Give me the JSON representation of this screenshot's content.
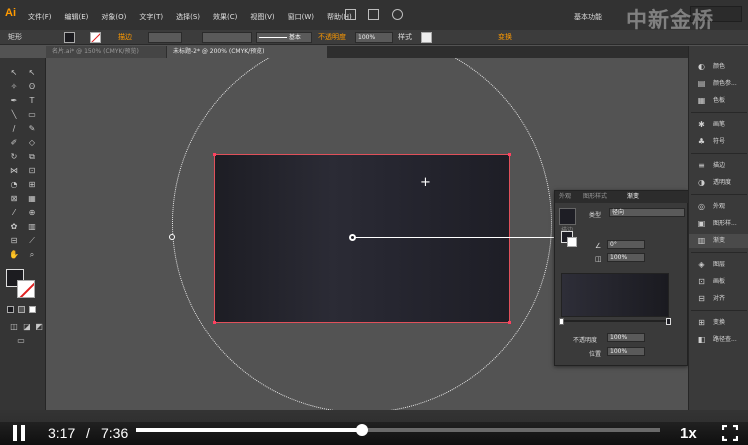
{
  "app": {
    "logo": "Ai"
  },
  "menu": {
    "items": [
      "文件(F)",
      "编辑(E)",
      "对象(O)",
      "文字(T)",
      "选择(S)",
      "效果(C)",
      "视图(V)",
      "窗口(W)",
      "帮助(H)"
    ]
  },
  "workspace": {
    "label": "基本功能"
  },
  "watermark": "中新金桥",
  "control_bar": {
    "selection_label": "矩形",
    "stroke_label": "描边",
    "basic_label": "基本",
    "opacity_label": "不透明度",
    "opacity_value": "100%",
    "style_label": "样式",
    "transform_label": "变换"
  },
  "tabs": [
    {
      "label": "名片.ai* @ 150% (CMYK/预览)"
    },
    {
      "label": "未标题-2* @ 200% (CMYK/预览)"
    }
  ],
  "gradient_panel": {
    "tabs": [
      "外观",
      "图形样式",
      "渐变"
    ],
    "type_label": "类型",
    "type_value": "径向",
    "stroke_label": "描边",
    "angle_value": "0°",
    "ratio_value": "100%",
    "opacity_label": "不透明度",
    "opacity_value": "100%",
    "location_label": "位置",
    "location_value": "100%"
  },
  "dock": {
    "items": [
      {
        "label": "颜色",
        "icon": "color-icon"
      },
      {
        "label": "颜色参...",
        "icon": "color-guide-icon"
      },
      {
        "label": "色板",
        "icon": "swatches-icon"
      },
      {
        "label": "画笔",
        "icon": "brush-icon"
      },
      {
        "label": "符号",
        "icon": "symbol-icon"
      },
      {
        "label": "描边",
        "icon": "stroke-icon"
      },
      {
        "label": "透明度",
        "icon": "transparency-icon"
      },
      {
        "label": "外观",
        "icon": "appearance-icon"
      },
      {
        "label": "图形样...",
        "icon": "graphic-styles-icon"
      },
      {
        "label": "渐变",
        "icon": "gradient-icon"
      },
      {
        "label": "图层",
        "icon": "layers-icon"
      },
      {
        "label": "画板",
        "icon": "artboards-icon"
      },
      {
        "label": "对齐",
        "icon": "align-icon"
      },
      {
        "label": "变换",
        "icon": "transform-icon"
      },
      {
        "label": "路径查...",
        "icon": "pathfinder-icon"
      }
    ]
  },
  "video": {
    "current_time": "3:17",
    "separator": "/",
    "total_time": "7:36",
    "progress": 0.432,
    "speed": "1x"
  }
}
